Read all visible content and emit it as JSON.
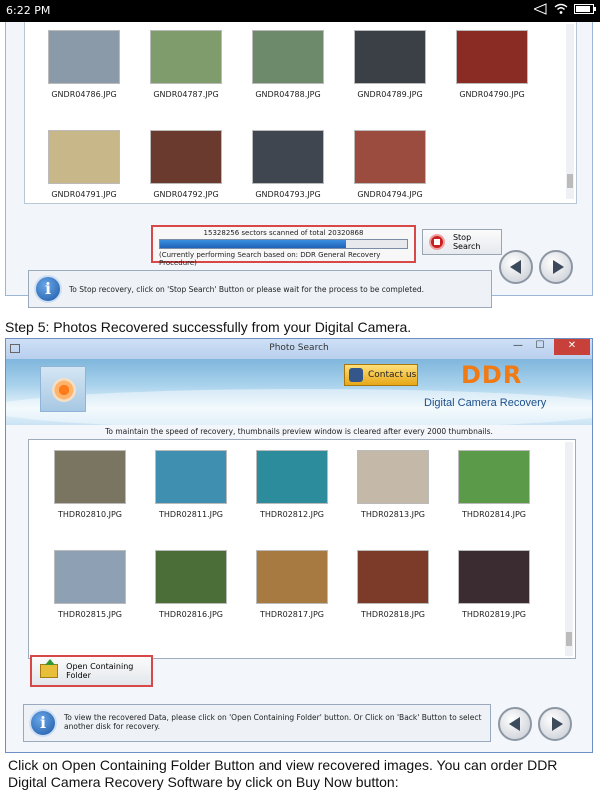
{
  "statusbar": {
    "time": "6:22 PM"
  },
  "panel1": {
    "thumbnails": [
      {
        "file": "GNDR04786.JPG",
        "color": "#8b9aa8"
      },
      {
        "file": "GNDR04787.JPG",
        "color": "#7f9c6d"
      },
      {
        "file": "GNDR04788.JPG",
        "color": "#6d8a6a"
      },
      {
        "file": "GNDR04789.JPG",
        "color": "#3b3f46"
      },
      {
        "file": "GNDR04790.JPG",
        "color": "#8a2c24"
      },
      {
        "file": "GNDR04791.JPG",
        "color": "#c8b889"
      },
      {
        "file": "GNDR04792.JPG",
        "color": "#6b3a2e"
      },
      {
        "file": "GNDR04793.JPG",
        "color": "#404650"
      },
      {
        "file": "GNDR04794.JPG",
        "color": "#9b4c3e"
      }
    ],
    "progress": {
      "text": "15328256 sectors scanned of total 20320868",
      "fraction": 0.754,
      "note": "(Currently performing Search based on:  DDR General Recovery Procedure)"
    },
    "stop_label": "Stop Search",
    "info_text": "To Stop recovery, click on 'Stop Search' Button or please wait for the process to be completed.",
    "info_icon": "i"
  },
  "caption_step5": "Step 5: Photos Recovered successfully from your Digital Camera.",
  "window": {
    "title": "Photo Search",
    "controls": {
      "min": "—",
      "max": "☐",
      "close": "✕"
    },
    "contact_label": "Contact us",
    "brand": "DDR",
    "product": "Digital Camera Recovery",
    "notice": "To maintain the speed of recovery, thumbnails preview window is cleared after every 2000 thumbnails.",
    "thumbnails": [
      {
        "file": "THDR02810.JPG",
        "color": "#7a7560"
      },
      {
        "file": "THDR02811.JPG",
        "color": "#3f8fb0"
      },
      {
        "file": "THDR02812.JPG",
        "color": "#2d8c9c"
      },
      {
        "file": "THDR02813.JPG",
        "color": "#c4b8a8"
      },
      {
        "file": "THDR02814.JPG",
        "color": "#5a9a48"
      },
      {
        "file": "THDR02815.JPG",
        "color": "#8ea0b4"
      },
      {
        "file": "THDR02816.JPG",
        "color": "#4b6e38"
      },
      {
        "file": "THDR02817.JPG",
        "color": "#a67a40"
      },
      {
        "file": "THDR02818.JPG",
        "color": "#7c3a28"
      },
      {
        "file": "THDR02819.JPG",
        "color": "#3a2c30"
      }
    ],
    "open_label": "Open Containing Folder",
    "info_text": "To view the recovered Data, please click on 'Open Containing Folder' button. Or Click on 'Back' Button to select another disk for recovery.",
    "info_icon": "i"
  },
  "caption_bottom": "Click on Open Containing Folder Button and view recovered images. You can order DDR Digital Camera Recovery Software by click on Buy Now button:"
}
